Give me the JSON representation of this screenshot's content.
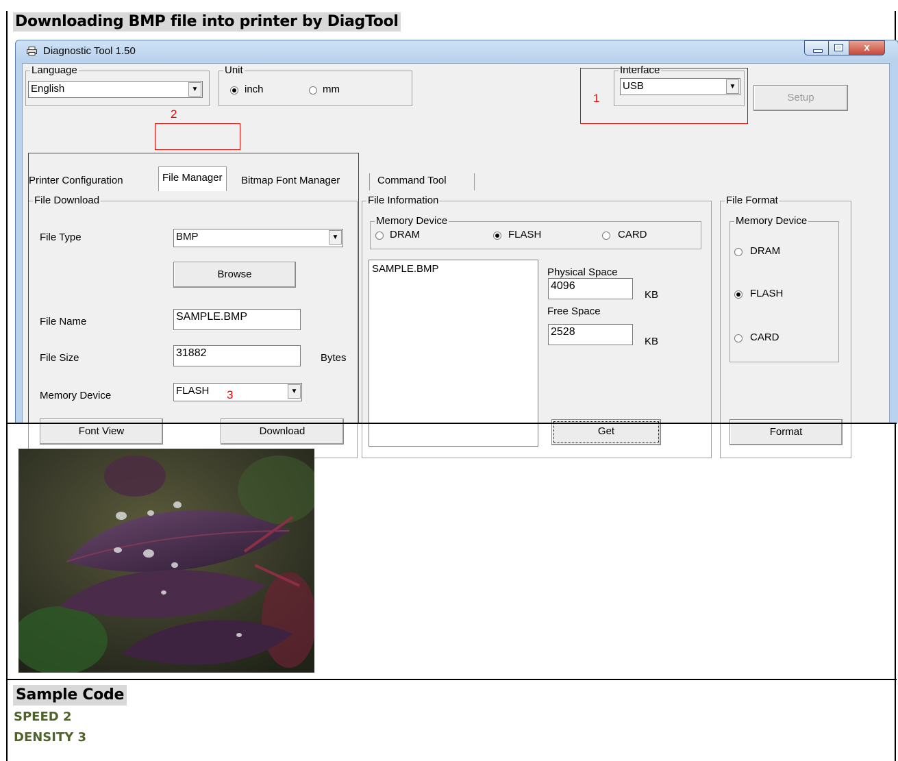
{
  "document": {
    "heading": "Downloading BMP file into printer by DiagTool",
    "sample_heading": "Sample Code",
    "code_lines": [
      "SPEED 2",
      "DENSITY 3"
    ]
  },
  "window": {
    "title": "Diagnostic Tool 1.50",
    "close_glyph": "x"
  },
  "language": {
    "legend": "Language",
    "value": "English"
  },
  "unit": {
    "legend": "Unit",
    "options": [
      "inch",
      "mm"
    ],
    "selected": "inch"
  },
  "interface": {
    "legend": "Interface",
    "value": "USB",
    "setup_label": "Setup"
  },
  "tabs": [
    "Printer Configuration",
    "File Manager",
    "Bitmap Font Manager",
    "Command Tool"
  ],
  "file_download": {
    "legend": "File Download",
    "file_type_label": "File Type",
    "file_type_value": "BMP",
    "browse_label": "Browse",
    "file_name_label": "File Name",
    "file_name_value": "SAMPLE.BMP",
    "file_size_label": "File Size",
    "file_size_value": "31882",
    "file_size_unit": "Bytes",
    "memory_device_label": "Memory Device",
    "memory_device_value": "FLASH",
    "font_view_label": "Font View",
    "download_label": "Download"
  },
  "file_information": {
    "legend": "File Information",
    "memory_legend": "Memory Device",
    "options": [
      "DRAM",
      "FLASH",
      "CARD"
    ],
    "selected": "FLASH",
    "files": [
      "SAMPLE.BMP"
    ],
    "physical_space_label": "Physical Space",
    "physical_space_value": "4096",
    "free_space_label": "Free Space",
    "free_space_value": "2528",
    "kb_unit": "KB",
    "get_label": "Get"
  },
  "file_format": {
    "legend": "File Format",
    "memory_legend": "Memory Device",
    "options": [
      "DRAM",
      "FLASH",
      "CARD"
    ],
    "selected": "FLASH",
    "format_label": "Format"
  },
  "annotations": [
    "1",
    "2",
    "3"
  ],
  "colors": {
    "annotation": "#e00000",
    "heading_bg": "#d8d8d8",
    "code_text": "#4f6228"
  },
  "image": {
    "subject": "purple leaf with water droplets"
  }
}
